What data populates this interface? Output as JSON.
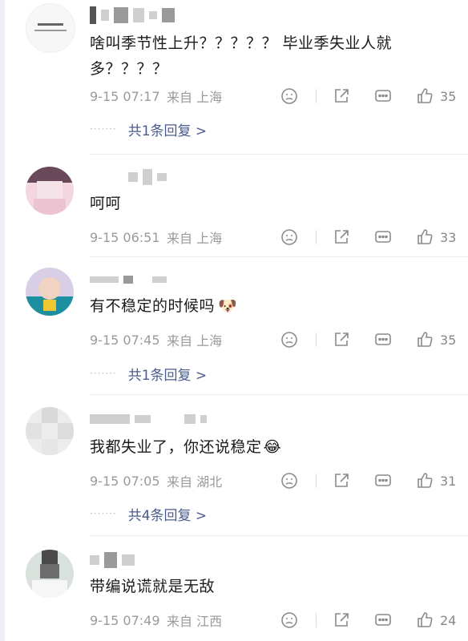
{
  "comments": [
    {
      "text": "啥叫季节性上升？？？？？ 毕业季失业人就多？？？？",
      "time": "9-15 07:17",
      "location": "来自 上海",
      "likes": "35",
      "replies": "共1条回复 >"
    },
    {
      "text": "呵呵",
      "time": "9-15 06:51",
      "location": "来自 上海",
      "likes": "33"
    },
    {
      "text": "有不稳定的时候吗",
      "emoji": "🐶",
      "time": "9-15 07:45",
      "location": "来自 上海",
      "likes": "35",
      "replies": "共1条回复 >"
    },
    {
      "text": "我都失业了，你还说稳定",
      "emoji": "😂",
      "time": "9-15 07:05",
      "location": "来自 湖北",
      "likes": "31",
      "replies": "共4条回复 >"
    },
    {
      "text": "带编说谎就是无敌",
      "time": "9-15 07:49",
      "location": "来自 江西",
      "likes": "24"
    }
  ],
  "reply_dashes": "·······"
}
